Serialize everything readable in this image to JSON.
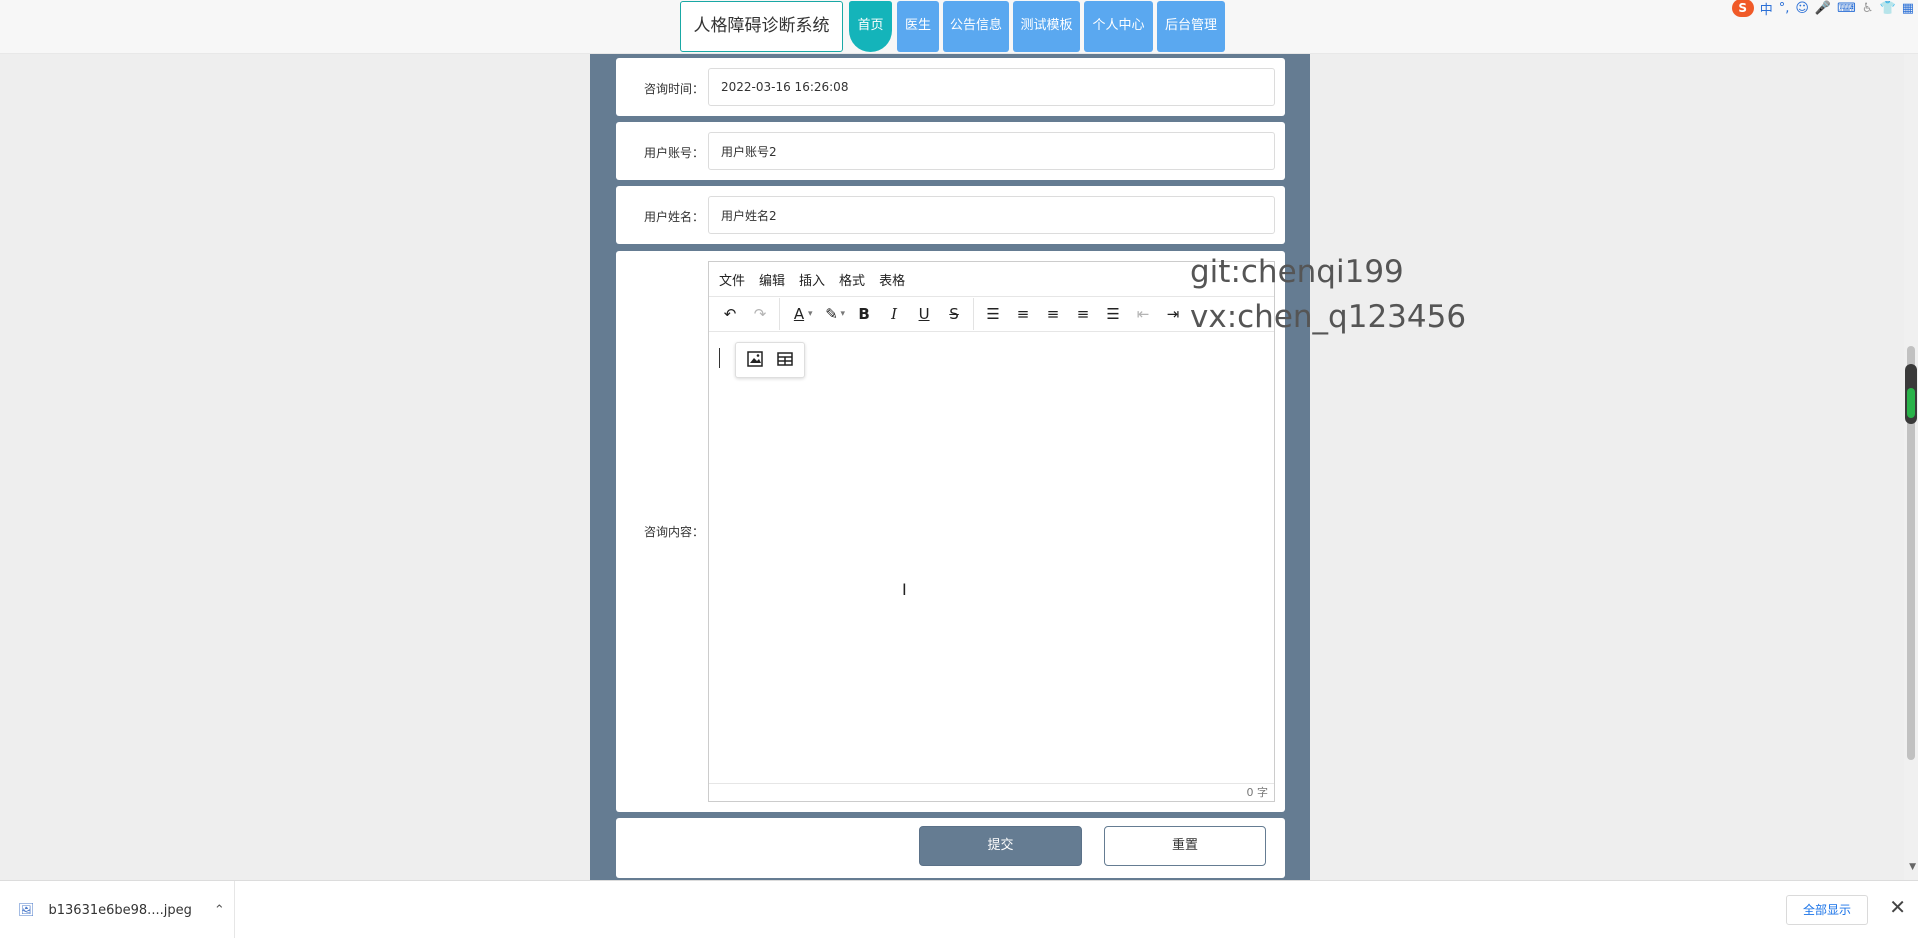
{
  "header": {
    "brand": "人格障碍诊断系统",
    "nav": [
      "首页",
      "医生",
      "公告信息",
      "测试模板",
      "个人中心",
      "后台管理"
    ],
    "active_index": 0
  },
  "systray": {
    "ime": "中",
    "punct": "°,",
    "logo": "S"
  },
  "form": {
    "fields": [
      {
        "label": "咨询时间：",
        "value": "2022-03-16 16:26:08"
      },
      {
        "label": "用户账号：",
        "value": "用户账号2"
      },
      {
        "label": "用户姓名：",
        "value": "用户姓名2"
      }
    ],
    "content_label": "咨询内容：",
    "editor": {
      "menus": [
        "文件",
        "编辑",
        "插入",
        "格式",
        "表格"
      ],
      "word_count": "0 字"
    },
    "submit_label": "提交",
    "reset_label": "重置"
  },
  "watermark": {
    "line1": "git:chenqi199",
    "line2": "vx:chen_q123456"
  },
  "download_bar": {
    "filename": "b13631e6be98....jpeg",
    "show_all": "全部显示"
  }
}
